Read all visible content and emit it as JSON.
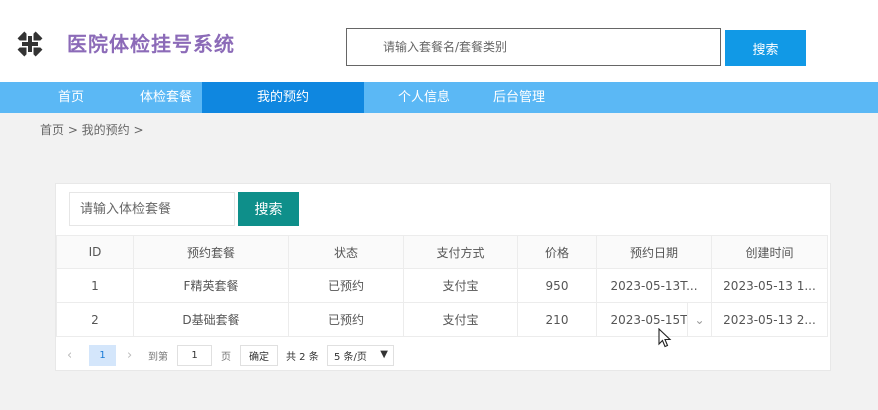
{
  "header": {
    "title": "医院体检挂号系统",
    "logo_icon": "hospital-cross-icon",
    "search_placeholder": "请输入套餐名/套餐类别",
    "search_button": "搜索"
  },
  "nav": {
    "items": [
      {
        "label": "首页",
        "active": false
      },
      {
        "label": "体检套餐",
        "active": false
      },
      {
        "label": "我的预约",
        "active": true
      },
      {
        "label": "个人信息",
        "active": false
      },
      {
        "label": "后台管理",
        "active": false
      }
    ]
  },
  "breadcrumb": "首页 > 我的预约 >",
  "filter": {
    "placeholder": "请输入体检套餐",
    "button": "搜索"
  },
  "table": {
    "columns": [
      "ID",
      "预约套餐",
      "状态",
      "支付方式",
      "价格",
      "预约日期",
      "创建时间"
    ],
    "rows": [
      [
        "1",
        "F精英套餐",
        "已预约",
        "支付宝",
        "950",
        "2023-05-13T...",
        "2023-05-13 1..."
      ],
      [
        "2",
        "D基础套餐",
        "已预约",
        "支付宝",
        "210",
        "2023-05-15T...",
        "2023-05-13 2..."
      ]
    ]
  },
  "pagination": {
    "current_page": "1",
    "goto_label": "到第",
    "goto_value": "1",
    "page_label": "页",
    "confirm": "确定",
    "total": "共 2 条",
    "page_size": "5 条/页"
  },
  "colors": {
    "accent": "#1199e6",
    "nav_bg": "#5bb8f5",
    "nav_active": "#0f87e0",
    "title": "#8c6bb8",
    "filter_button": "#0e8f8a"
  }
}
